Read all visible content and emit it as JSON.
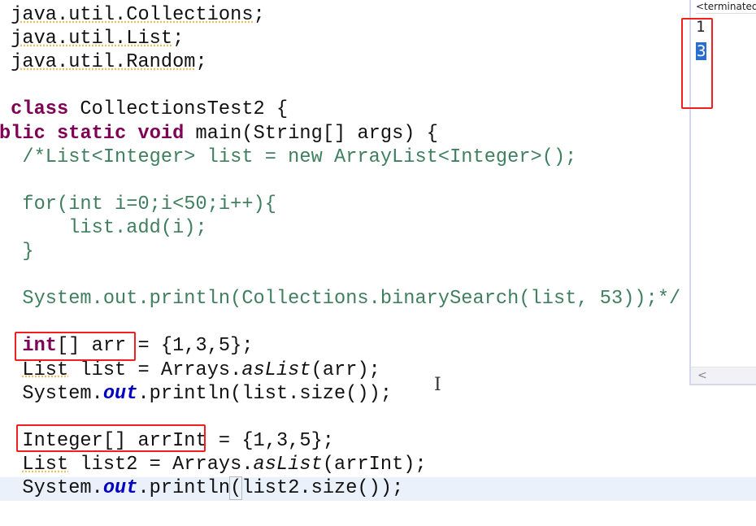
{
  "editor": {
    "lines": [
      {
        "row": 0,
        "col": 1,
        "tokens": [
          {
            "t": "java.util.Collections",
            "k": "warn"
          },
          {
            "t": ";"
          }
        ]
      },
      {
        "row": 1,
        "col": 1,
        "tokens": [
          {
            "t": "java.util.List",
            "k": "warn"
          },
          {
            "t": ";"
          }
        ]
      },
      {
        "row": 2,
        "col": 1,
        "tokens": [
          {
            "t": "java.util.Random",
            "k": "warn"
          },
          {
            "t": ";"
          }
        ]
      },
      {
        "row": 4,
        "col": 1,
        "tokens": [
          {
            "t": "class",
            "k": "kw"
          },
          {
            "t": " CollectionsTest2 {"
          }
        ]
      },
      {
        "row": 5,
        "col": 0,
        "tokens": [
          {
            "t": "blic static void",
            "k": "kw"
          },
          {
            "t": " main(String[] args) {"
          }
        ]
      },
      {
        "row": 6,
        "col": 2,
        "tokens": [
          {
            "t": "/*List<Integer> list = new ArrayList<Integer>();",
            "k": "cm"
          }
        ]
      },
      {
        "row": 8,
        "col": 2,
        "tokens": [
          {
            "t": "for(int i=0;i<50;i++){",
            "k": "cm"
          }
        ]
      },
      {
        "row": 9,
        "col": 2,
        "tokens": [
          {
            "t": "    list.add(i);",
            "k": "cm"
          }
        ]
      },
      {
        "row": 10,
        "col": 2,
        "tokens": [
          {
            "t": "}",
            "k": "cm"
          }
        ]
      },
      {
        "row": 12,
        "col": 2,
        "tokens": [
          {
            "t": "System.out.println(Collections.binarySearch(list, 53));*/",
            "k": "cm"
          }
        ]
      },
      {
        "row": 14,
        "col": 2,
        "tokens": [
          {
            "t": "int",
            "k": "kw"
          },
          {
            "t": "[] arr = {1,3,5};"
          }
        ]
      },
      {
        "row": 15,
        "col": 2,
        "tokens": [
          {
            "t": "List",
            "k": "warn"
          },
          {
            "t": " list = Arrays."
          },
          {
            "t": "asList",
            "k": "st"
          },
          {
            "t": "(arr);"
          }
        ]
      },
      {
        "row": 16,
        "col": 2,
        "tokens": [
          {
            "t": "System."
          },
          {
            "t": "out",
            "k": "fld"
          },
          {
            "t": ".println(list.size());"
          }
        ]
      },
      {
        "row": 18,
        "col": 2,
        "tokens": [
          {
            "t": "Integer[] arrInt = {1,3,5};"
          }
        ]
      },
      {
        "row": 19,
        "col": 2,
        "tokens": [
          {
            "t": "List",
            "k": "warn"
          },
          {
            "t": " list2 = Arrays."
          },
          {
            "t": "asList",
            "k": "st"
          },
          {
            "t": "(arrInt);"
          }
        ]
      },
      {
        "row": 20,
        "col": 2,
        "tokens": [
          {
            "t": "System."
          },
          {
            "t": "out",
            "k": "fld"
          },
          {
            "t": ".println"
          },
          {
            "t": "(",
            "k": "bracket-box"
          },
          {
            "t": "list2.size());"
          }
        ]
      }
    ],
    "current_line_row": 20
  },
  "console": {
    "header": "<terminated>",
    "output": [
      "1",
      "3"
    ],
    "selected_output_index": 1,
    "scroll_left_arrow": "<"
  },
  "annotation_color": "#f02020",
  "colors": {
    "keyword": "#7f0055",
    "comment": "#3f7f5f",
    "field": "#0000c0",
    "selection": "#2a6fd0"
  }
}
